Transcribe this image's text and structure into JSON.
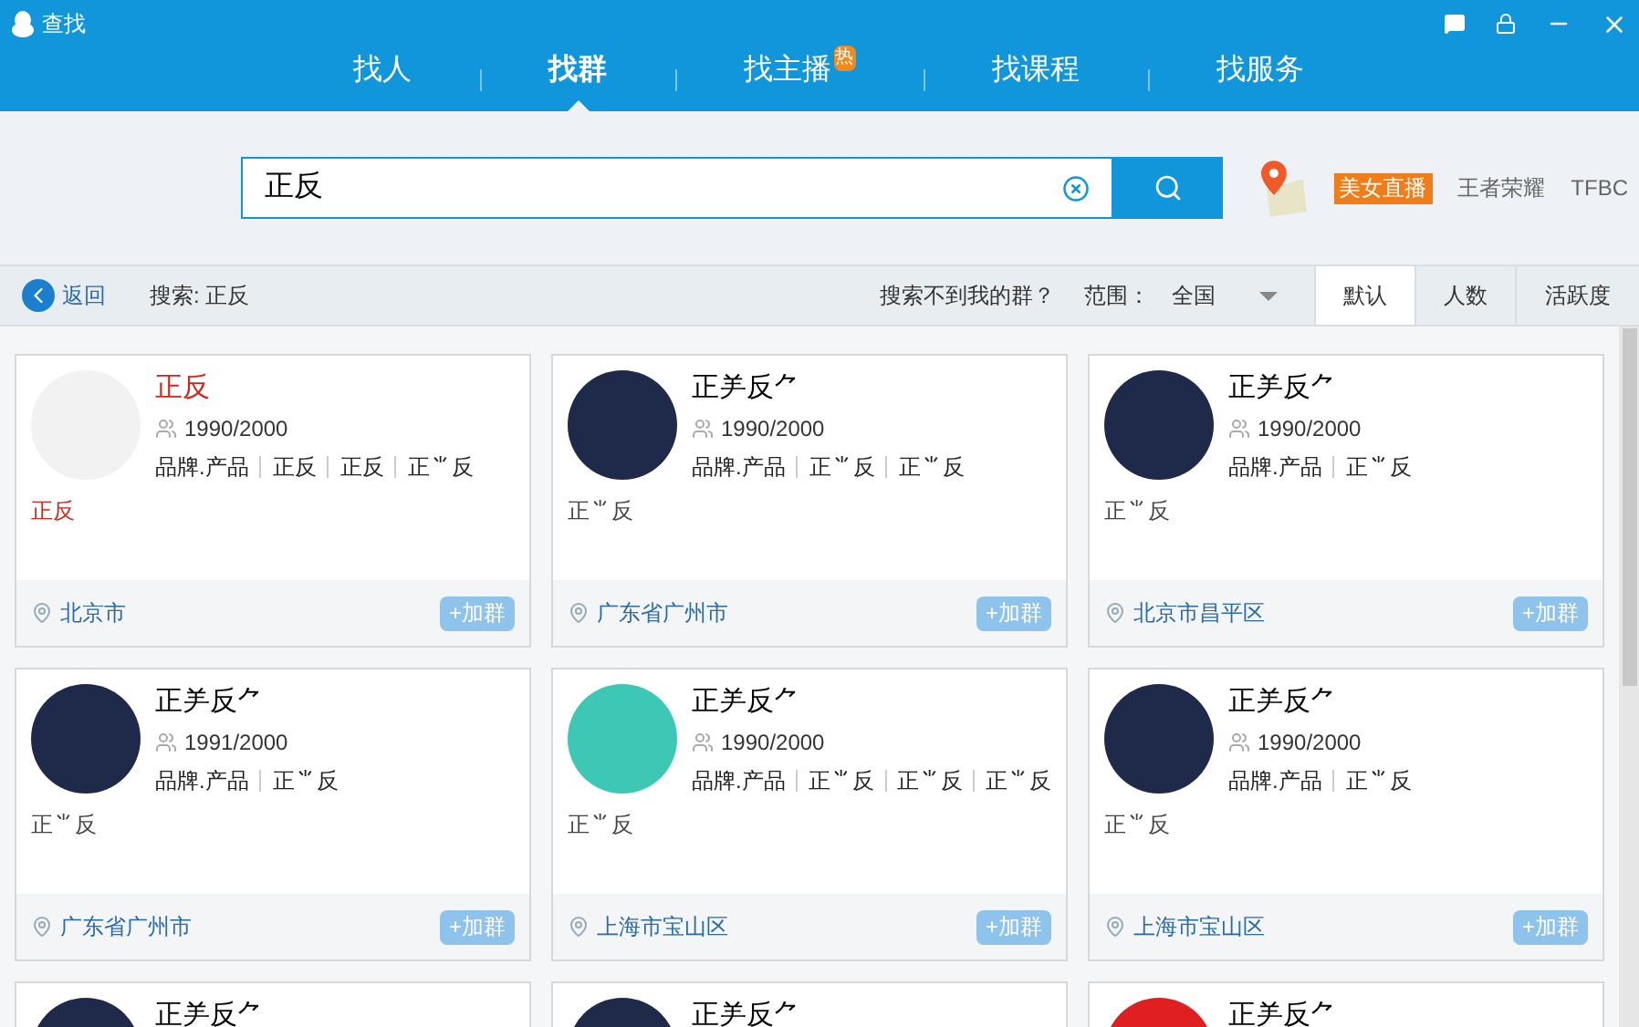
{
  "window": {
    "title": "查找"
  },
  "tabs": [
    {
      "label": "找人",
      "selected": false
    },
    {
      "label": "找群",
      "selected": true
    },
    {
      "label": "找主播",
      "selected": false,
      "badge": "热"
    },
    {
      "label": "找课程",
      "selected": false
    },
    {
      "label": "找服务",
      "selected": false
    }
  ],
  "search": {
    "value": "正反"
  },
  "promos": [
    {
      "label": "美女直播",
      "kind": "badge"
    },
    {
      "label": "王者荣耀",
      "kind": "link"
    },
    {
      "label": "TFBC",
      "kind": "link"
    }
  ],
  "toolbar": {
    "back": "返回",
    "query": "搜索: 正反",
    "help": "搜索不到我的群？",
    "range_label": "范围：",
    "range": "全国",
    "sorts": [
      {
        "label": "默认",
        "selected": true
      },
      {
        "label": "人数",
        "selected": false
      },
      {
        "label": "活跃度",
        "selected": false
      }
    ]
  },
  "cards": [
    {
      "name": "正反",
      "highlight": true,
      "avatar": {
        "color": "#f2f2f2"
      },
      "members": "1990/2000",
      "tags": [
        "品牌.产品",
        "正反",
        "正反",
        "正⺌反"
      ],
      "desc": "正反",
      "location": "北京市",
      "join": "+加群"
    },
    {
      "name": "正⺶反⺈",
      "highlight": false,
      "avatar": {
        "color": "#1f2a4a"
      },
      "members": "1990/2000",
      "tags": [
        "品牌.产品",
        "正⺌反",
        "正⺌反"
      ],
      "desc": "正⺌反",
      "location": "广东省广州市",
      "join": "+加群"
    },
    {
      "name": "正⺶反⺈",
      "highlight": false,
      "avatar": {
        "color": "#1f2a4a"
      },
      "members": "1990/2000",
      "tags": [
        "品牌.产品",
        "正⺌反"
      ],
      "desc": "正⺌反",
      "location": "北京市昌平区",
      "join": "+加群"
    },
    {
      "name": "正⺶反⺈",
      "highlight": false,
      "avatar": {
        "color": "#1f2a4a"
      },
      "members": "1991/2000",
      "tags": [
        "品牌.产品",
        "正⺌反"
      ],
      "desc": "正⺌反",
      "location": "广东省广州市",
      "join": "+加群"
    },
    {
      "name": "正⺶反⺈",
      "highlight": false,
      "avatar": {
        "color": "#3cc8b4"
      },
      "members": "1990/2000",
      "tags": [
        "品牌.产品",
        "正⺌反",
        "正⺌反",
        "正⺌反"
      ],
      "desc": "正⺌反",
      "location": "上海市宝山区",
      "join": "+加群"
    },
    {
      "name": "正⺶反⺈",
      "highlight": false,
      "avatar": {
        "color": "#1f2a4a"
      },
      "members": "1990/2000",
      "tags": [
        "品牌.产品",
        "正⺌反"
      ],
      "desc": "正⺌反",
      "location": "上海市宝山区",
      "join": "+加群"
    },
    {
      "name": "正⺶反⺈",
      "highlight": false,
      "avatar": {
        "color": "#1f2a4a"
      }
    },
    {
      "name": "正⺶反⺈",
      "highlight": false,
      "avatar": {
        "color": "#1f2a4a"
      }
    },
    {
      "name": "正⺶反⺈",
      "highlight": false,
      "avatar": {
        "color": "#e02020"
      }
    }
  ]
}
